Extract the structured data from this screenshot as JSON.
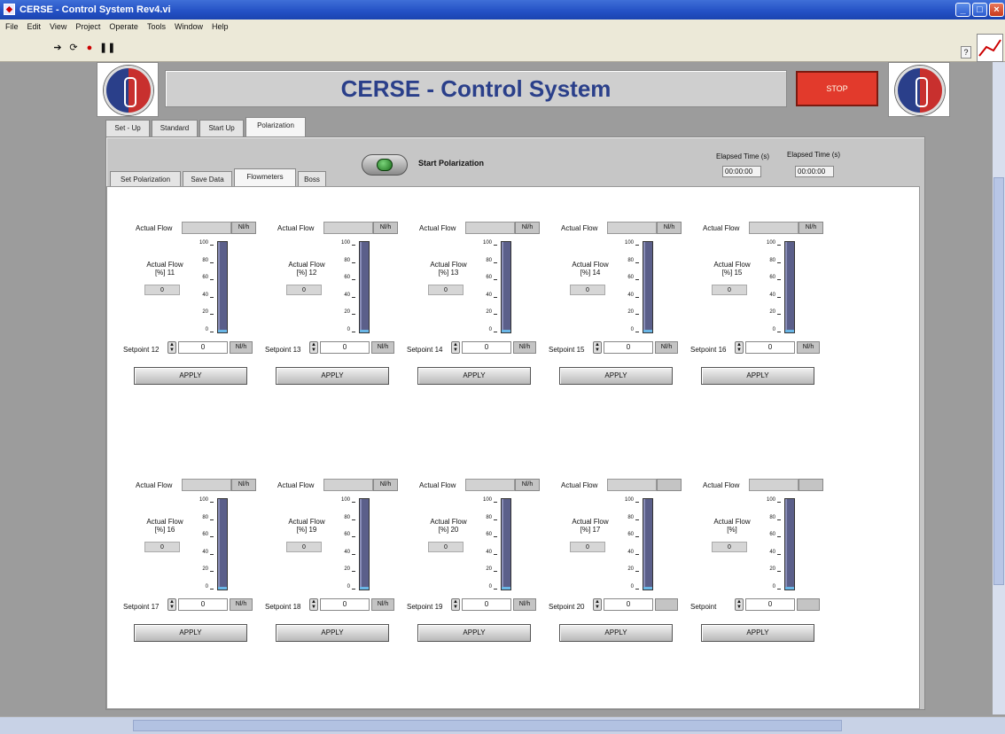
{
  "window": {
    "title": "CERSE - Control System Rev4.vi",
    "min": "_",
    "max": "□",
    "close": "×"
  },
  "menu": [
    "File",
    "Edit",
    "View",
    "Project",
    "Operate",
    "Tools",
    "Window",
    "Help"
  ],
  "toolbar": {
    "help": "?"
  },
  "header": {
    "title": "CERSE - Control System",
    "stop_label": "STOP"
  },
  "main_tabs": [
    {
      "label": "Set - Up",
      "active": false
    },
    {
      "label": "Standard",
      "active": false
    },
    {
      "label": "Start Up",
      "active": false
    },
    {
      "label": "Polarization",
      "active": true
    }
  ],
  "sub_tabs": [
    {
      "label": "Set Polarization",
      "active": false
    },
    {
      "label": "Save Data",
      "active": false
    },
    {
      "label": "Flowmeters",
      "active": true
    },
    {
      "label": "Boss",
      "active": false
    }
  ],
  "start": {
    "label": "Start Polarization"
  },
  "elapsed": [
    {
      "label": "Elapsed Time (s)",
      "value": "0"
    },
    {
      "label": "Elapsed Time (s)",
      "value": "00:00:00"
    }
  ],
  "scale": [
    "100",
    "80",
    "60",
    "40",
    "20",
    "0"
  ],
  "flowmeters": [
    {
      "actual_label": "Actual Flow",
      "unit": "Nl/h",
      "pct_label": "Actual Flow [%] 11",
      "pct_value": "0",
      "setpoint_label": "Setpoint 12",
      "setpoint_value": "0",
      "apply": "APPLY",
      "level": 0.02
    },
    {
      "actual_label": "Actual Flow",
      "unit": "Nl/h",
      "pct_label": "Actual Flow [%] 12",
      "pct_value": "0",
      "setpoint_label": "Setpoint 13",
      "setpoint_value": "0",
      "apply": "APPLY",
      "level": 0.02
    },
    {
      "actual_label": "Actual Flow",
      "unit": "Nl/h",
      "pct_label": "Actual Flow [%] 13",
      "pct_value": "0",
      "setpoint_label": "Setpoint 14",
      "setpoint_value": "0",
      "apply": "APPLY",
      "level": 0.02
    },
    {
      "actual_label": "Actual Flow",
      "unit": "Nl/h",
      "pct_label": "Actual Flow [%] 14",
      "pct_value": "0",
      "setpoint_label": "Setpoint 15",
      "setpoint_value": "0",
      "apply": "APPLY",
      "level": 0.02
    },
    {
      "actual_label": "Actual Flow",
      "unit": "Nl/h",
      "pct_label": "Actual Flow [%] 15",
      "pct_value": "0",
      "setpoint_label": "Setpoint 16",
      "setpoint_value": "0",
      "apply": "APPLY",
      "level": 0.02
    },
    {
      "actual_label": "Actual Flow",
      "unit": "Nl/h",
      "pct_label": "Actual Flow [%] 16",
      "pct_value": "0",
      "setpoint_label": "Setpoint 17",
      "setpoint_value": "0",
      "apply": "APPLY",
      "level": 0.02
    },
    {
      "actual_label": "Actual Flow",
      "unit": "Nl/h",
      "pct_label": "Actual Flow [%] 19",
      "pct_value": "0",
      "setpoint_label": "Setpoint 18",
      "setpoint_value": "0",
      "apply": "APPLY",
      "level": 0.02
    },
    {
      "actual_label": "Actual Flow",
      "unit": "Nl/h",
      "pct_label": "Actual Flow [%] 20",
      "pct_value": "0",
      "setpoint_label": "Setpoint 19",
      "setpoint_value": "0",
      "apply": "APPLY",
      "level": 0.02
    },
    {
      "actual_label": "Actual Flow",
      "unit": "",
      "pct_label": "Actual Flow [%] 17",
      "pct_value": "0",
      "setpoint_label": "Setpoint 20",
      "setpoint_value": "0",
      "apply": "APPLY",
      "level": 0.02
    },
    {
      "actual_label": "Actual Flow",
      "unit": "",
      "pct_label": "Actual Flow [%]",
      "pct_value": "0",
      "setpoint_label": "Setpoint",
      "setpoint_value": "0",
      "apply": "APPLY",
      "level": 0.02
    }
  ]
}
